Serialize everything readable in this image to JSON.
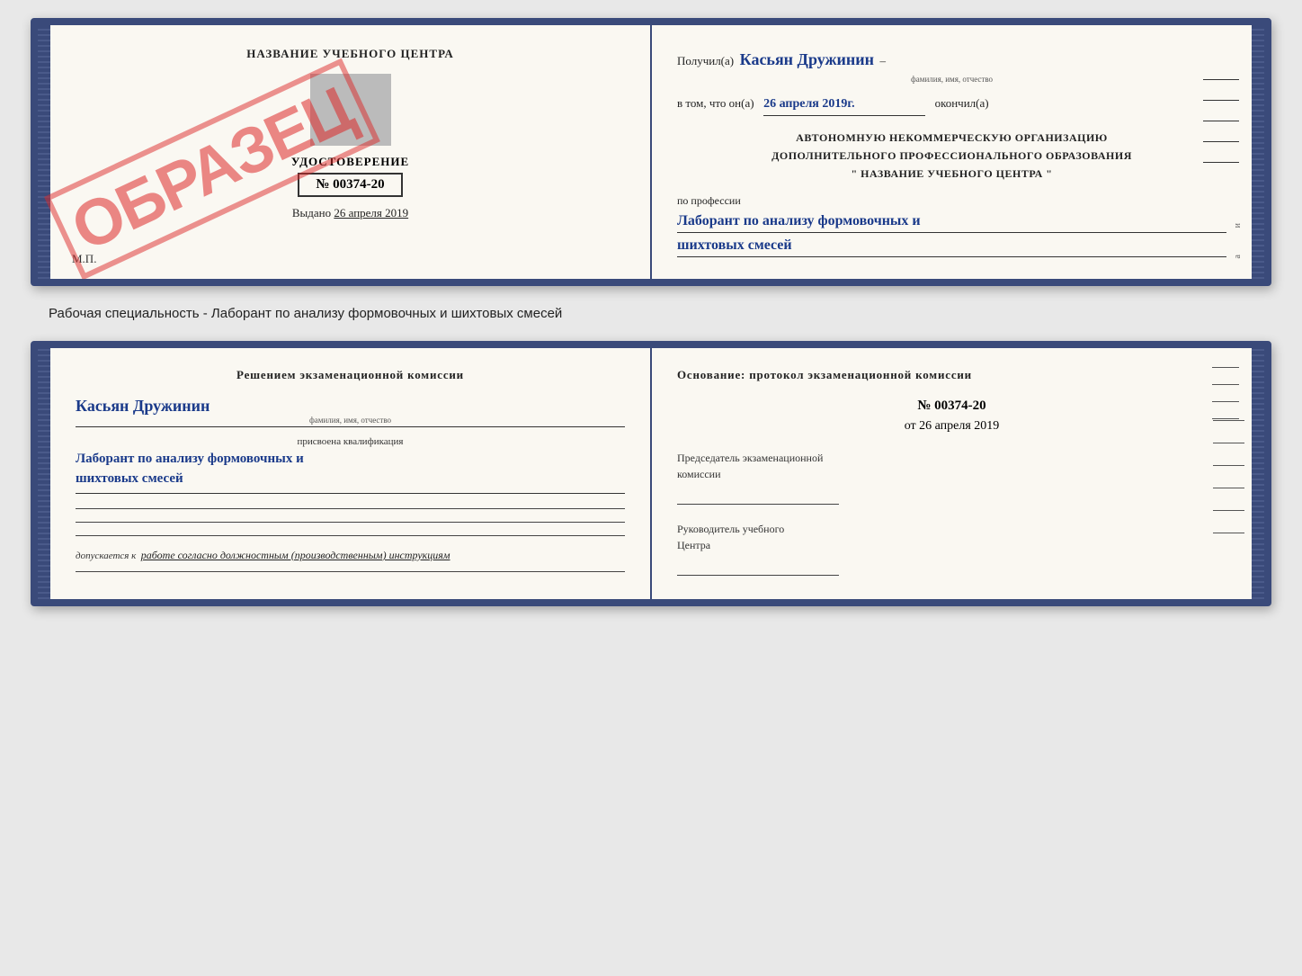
{
  "top_book": {
    "left_page": {
      "title": "НАЗВАНИЕ УЧЕБНОГО ЦЕНТРА",
      "cert_label": "УДОСТОВЕРЕНИЕ",
      "cert_number": "№ 00374-20",
      "issued_text": "Выдано",
      "issued_date": "26 апреля 2019",
      "mp_label": "М.П.",
      "stamp_text": "ОБРАЗЕЦ"
    },
    "right_page": {
      "received_label": "Получил(а)",
      "recipient_name": "Касьян Дружинин",
      "recipient_sub": "фамилия, имя, отчество",
      "in_that_label": "в том, что он(а)",
      "date_value": "26 апреля 2019г.",
      "finished_label": "окончил(а)",
      "org_line1": "АВТОНОМНУЮ НЕКОММЕРЧЕСКУЮ ОРГАНИЗАЦИЮ",
      "org_line2": "ДОПОЛНИТЕЛЬНОГО ПРОФЕССИОНАЛЬНОГО ОБРАЗОВАНИЯ",
      "org_line3": "\"  НАЗВАНИЕ УЧЕБНОГО ЦЕНТРА  \"",
      "profession_label": "по профессии",
      "profession_handwritten1": "Лаборант по анализу формовочных и",
      "profession_handwritten2": "шихтовых смесей"
    }
  },
  "specialty_label": "Рабочая специальность - Лаборант по анализу формовочных и шихтовых смесей",
  "bottom_book": {
    "left_page": {
      "decision_title": "Решением  экзаменационной  комиссии",
      "name_handwritten": "Касьян  Дружинин",
      "name_sub": "фамилия, имя, отчество",
      "assigned_label": "присвоена квалификация",
      "qualification_line1": "Лаборант по анализу формовочных и",
      "qualification_line2": "шихтовых смесей",
      "allowed_label": "допускается к",
      "allowed_text": "работе согласно должностным (производственным) инструкциям"
    },
    "right_page": {
      "basis_title": "Основание: протокол экзаменационной  комиссии",
      "protocol_number": "№ 00374-20",
      "protocol_date_prefix": "от",
      "protocol_date": "26 апреля 2019",
      "chairman_label1": "Председатель экзаменационной",
      "chairman_label2": "комиссии",
      "director_label1": "Руководитель учебного",
      "director_label2": "Центра"
    }
  }
}
